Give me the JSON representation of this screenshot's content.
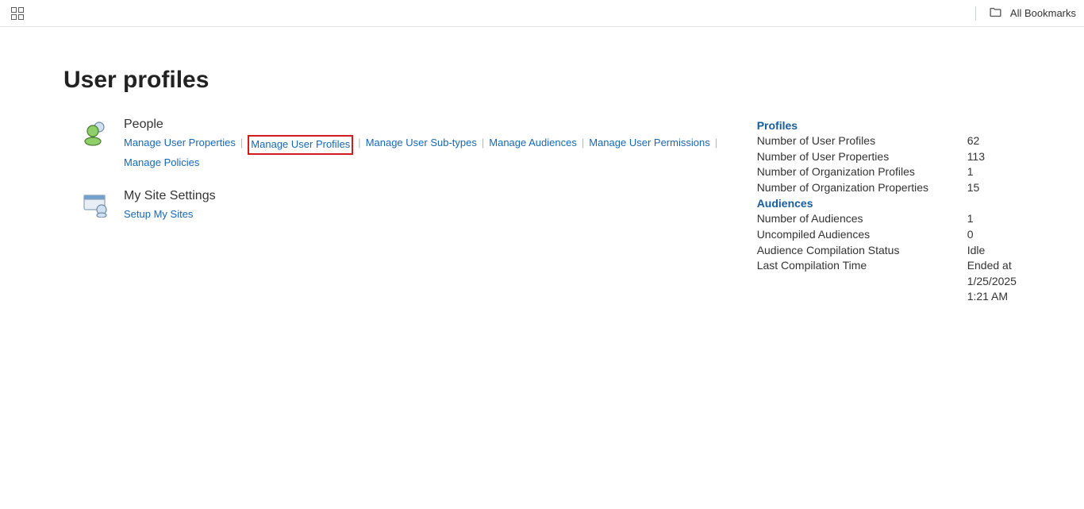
{
  "topbar": {
    "all_bookmarks": "All Bookmarks"
  },
  "page": {
    "title": "User profiles"
  },
  "people": {
    "title": "People",
    "links": {
      "manage_user_properties": "Manage User Properties",
      "manage_user_profiles": "Manage User Profiles",
      "manage_user_subtypes": "Manage User Sub-types",
      "manage_audiences": "Manage Audiences",
      "manage_user_permissions": "Manage User Permissions",
      "manage_policies": "Manage Policies"
    }
  },
  "mysite": {
    "title": "My Site Settings",
    "links": {
      "setup_my_sites": "Setup My Sites"
    }
  },
  "stats": {
    "profiles_header": "Profiles",
    "audiences_header": "Audiences",
    "rows": {
      "num_user_profiles_label": "Number of User Profiles",
      "num_user_profiles_value": "62",
      "num_user_properties_label": "Number of User Properties",
      "num_user_properties_value": "113",
      "num_org_profiles_label": "Number of Organization Profiles",
      "num_org_profiles_value": "1",
      "num_org_properties_label": "Number of Organization Properties",
      "num_org_properties_value": "15",
      "num_audiences_label": "Number of Audiences",
      "num_audiences_value": "1",
      "uncompiled_audiences_label": "Uncompiled Audiences",
      "uncompiled_audiences_value": "0",
      "audience_comp_status_label": "Audience Compilation Status",
      "audience_comp_status_value": "Idle",
      "last_comp_time_label": "Last Compilation Time",
      "last_comp_time_value": "Ended at 1/25/2025 1:21 AM"
    }
  }
}
